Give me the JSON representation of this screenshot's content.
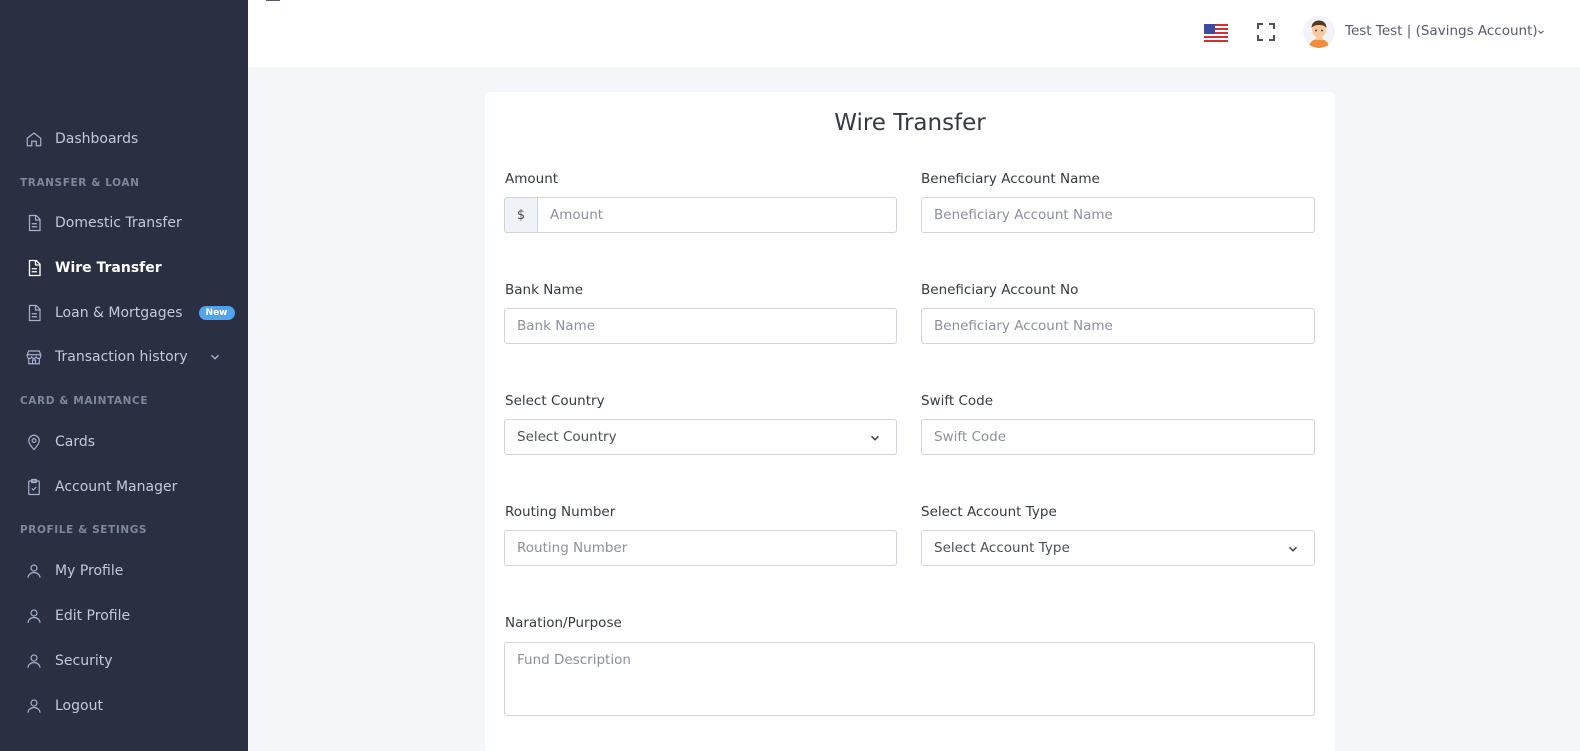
{
  "sidebar": {
    "items": [
      {
        "label": "Dashboards",
        "icon": "home-icon"
      },
      {
        "label": "Domestic Transfer",
        "icon": "document-icon"
      },
      {
        "label": "Wire Transfer",
        "icon": "document-icon"
      },
      {
        "label": "Loan & Mortgages",
        "icon": "document-icon",
        "badge": "New"
      },
      {
        "label": "Transaction history",
        "icon": "store-icon"
      },
      {
        "label": "Cards",
        "icon": "map-pin-icon"
      },
      {
        "label": "Account Manager",
        "icon": "clipboard-check-icon"
      },
      {
        "label": "My Profile",
        "icon": "user-icon"
      },
      {
        "label": "Edit Profile",
        "icon": "user-icon"
      },
      {
        "label": "Security",
        "icon": "user-icon"
      },
      {
        "label": "Logout",
        "icon": "user-icon"
      }
    ],
    "sections": {
      "transfer": "TRANSFER & LOAN",
      "card": "CARD & MAINTANCE",
      "profile": "PROFILE & SETINGS"
    },
    "active": "Wire Transfer"
  },
  "topbar": {
    "user_name": "Test Test | (Savings Account)",
    "flag": "us-flag-icon"
  },
  "form": {
    "title": "Wire Transfer",
    "amount": {
      "label": "Amount",
      "addon": "$",
      "placeholder": "Amount",
      "value": ""
    },
    "beneficiary_name": {
      "label": "Beneficiary Account Name",
      "placeholder": "Beneficiary Account Name",
      "value": ""
    },
    "bank_name": {
      "label": "Bank Name",
      "placeholder": "Bank Name",
      "value": ""
    },
    "beneficiary_no": {
      "label": "Beneficiary Account No",
      "placeholder": "Beneficiary Account Name",
      "value": ""
    },
    "country": {
      "label": "Select Country",
      "selected": "Select Country"
    },
    "swift": {
      "label": "Swift Code",
      "placeholder": "Swift Code",
      "value": ""
    },
    "routing": {
      "label": "Routing Number",
      "placeholder": "Routing Number",
      "value": ""
    },
    "account_type": {
      "label": "Select Account Type",
      "selected": "Select Account Type"
    },
    "purpose": {
      "label": "Naration/Purpose",
      "placeholder": "Fund Description",
      "value": ""
    }
  },
  "colors": {
    "sidebar_bg": "#2a3042",
    "badge": "#50a5f1",
    "page_bg": "#f5f6fa"
  }
}
